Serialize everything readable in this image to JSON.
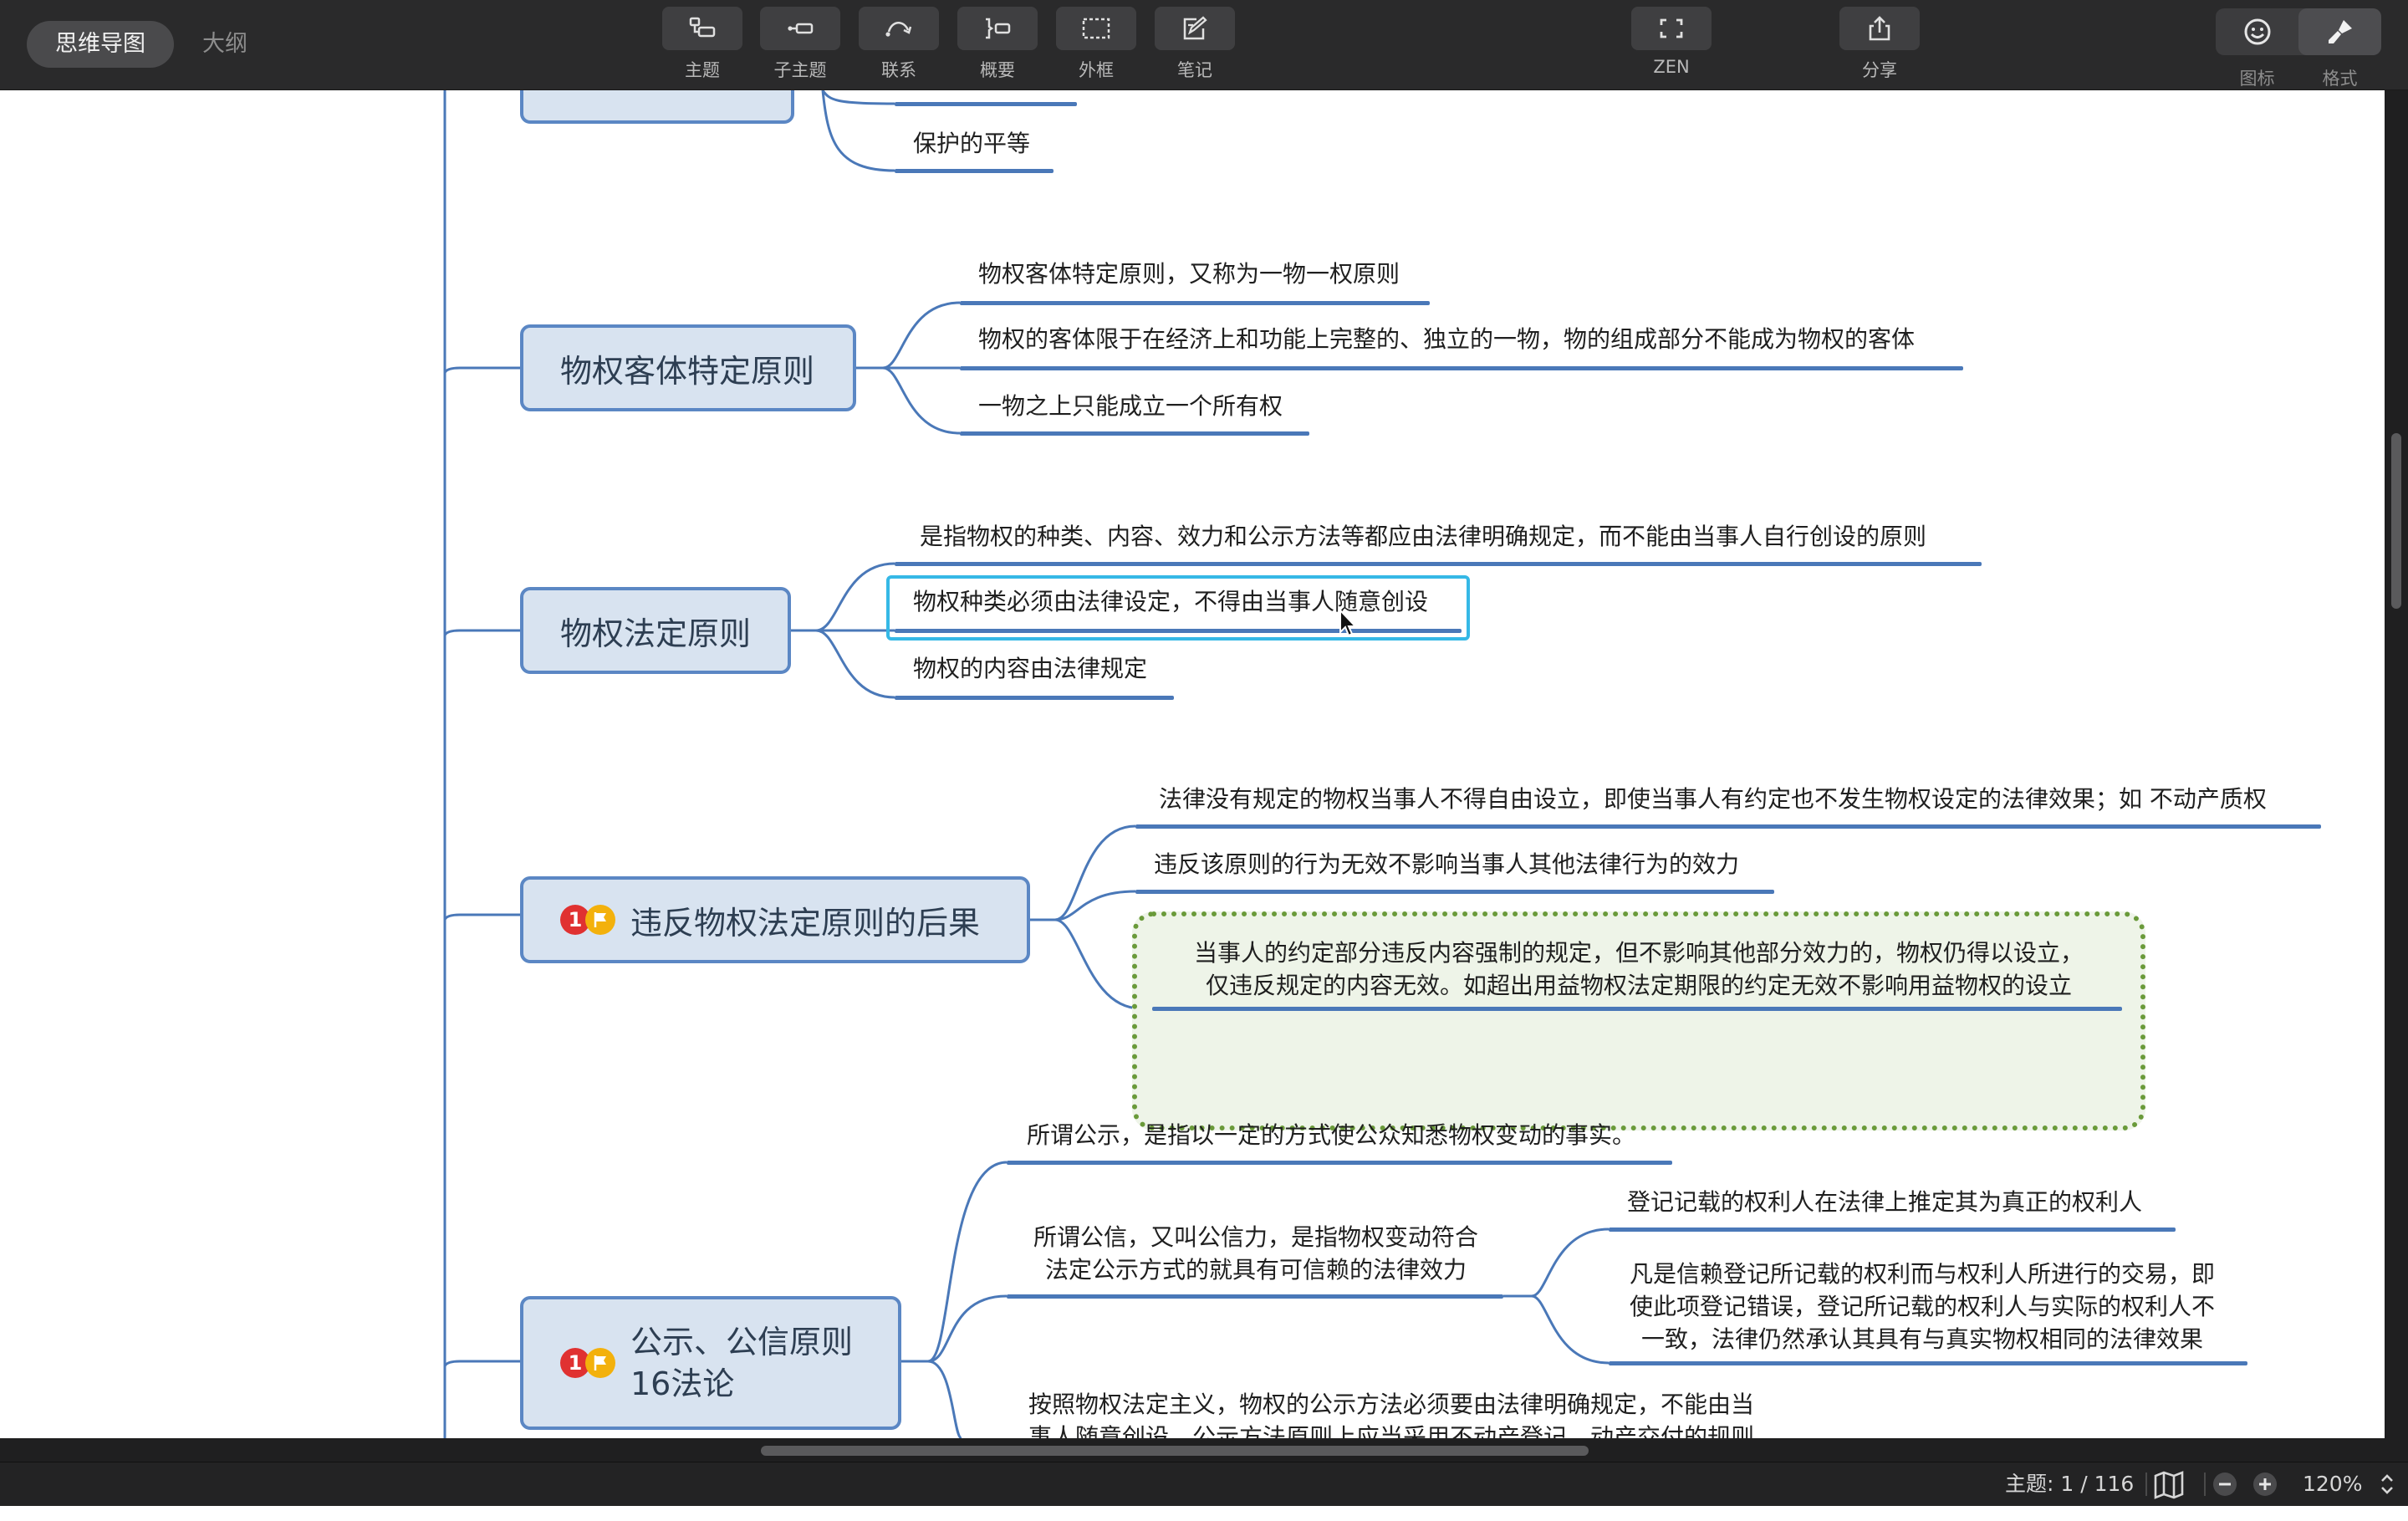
{
  "toolbar": {
    "modes": {
      "mindmap": "思维导图",
      "outline": "大纲"
    },
    "tools": {
      "topic": "主题",
      "subtopic": "子主题",
      "relationship": "联系",
      "summary": "概要",
      "boundary": "外框",
      "note": "笔记",
      "zen": "ZEN",
      "share": "分享",
      "icon": "图标",
      "format": "格式"
    }
  },
  "map": {
    "partial_top_child": "保护的平等",
    "branches": [
      {
        "label": "物权客体特定原则",
        "children": [
          "物权客体特定原则，又称为一物一权原则",
          "物权的客体限于在经济上和功能上完整的、独立的一物，物的组成部分不能成为物权的客体",
          "一物之上只能成立一个所有权"
        ]
      },
      {
        "label": "物权法定原则",
        "children": [
          "是指物权的种类、内容、效力和公示方法等都应由法律明确规定，而不能由当事人自行创设的原则",
          "物权种类必须由法律设定，不得由当事人随意创设",
          "物权的内容由法律规定"
        ]
      },
      {
        "label": "违反物权法定原则的后果",
        "priority": "1",
        "children": [
          "法律没有规定的物权当事人不得自由设立，即使当事人有约定也不发生物权设定的法律效果；如 不动产质权",
          "违反该原则的行为无效不影响当事人其他法律行为的效力"
        ],
        "boundary_lines": [
          "当事人的约定部分违反内容强制的规定，但不影响其他部分效力的，物权仍得以设立，",
          "仅违反规定的内容无效。如超出用益物权法定期限的约定无效不影响用益物权的设立"
        ]
      },
      {
        "label_lines": [
          "公示、公信原则",
          "16法论"
        ],
        "priority": "1",
        "children": [
          "所谓公示，是指以一定的方式使公众知悉物权变动的事实。"
        ],
        "gongxin_lines": [
          "所谓公信，又叫公信力，是指物权变动符合",
          "法定公示方式的就具有可信赖的法律效力"
        ],
        "gongxin_children": [
          "登记记载的权利人在法律上推定其为真正的权利人"
        ],
        "gongxin_child2_lines": [
          "凡是信赖登记所记载的权利而与权利人所进行的交易，即",
          "使此项登记错误，登记所记载的权利人与实际的权利人不",
          "一致，法律仍然承认其具有与真实物权相同的法律效果"
        ],
        "partial_bottom_lines": [
          "按照物权法定主义，物权的公示方法必须要由法律明确规定，不能由当",
          "事人随意创设。公示方法原则上应当采用不动产登记、动产交付的规则"
        ]
      }
    ]
  },
  "status": {
    "topic_count": "主题: 1 / 116",
    "zoom": "120%"
  },
  "colors": {
    "toolbar_bg": "#2a2a2b",
    "topic_fill": "#d8e3f0",
    "topic_border": "#5b87c4",
    "branch_line": "#4a78b8",
    "selection": "#35b8e6",
    "boundary": "#6a9a3a"
  }
}
